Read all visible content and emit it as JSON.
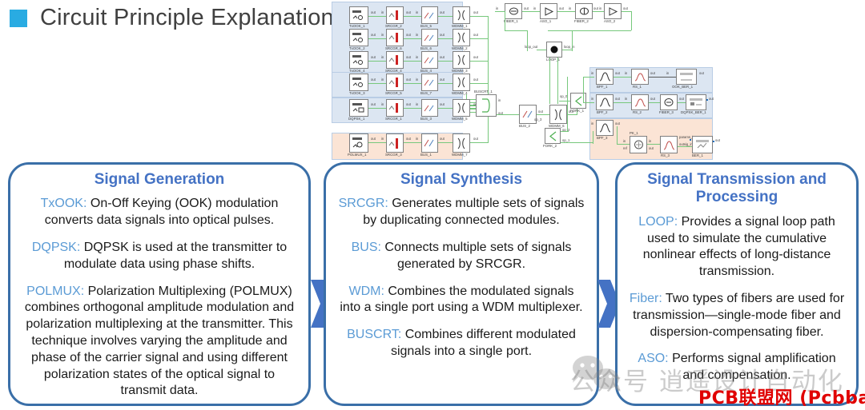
{
  "title": {
    "text": "Circuit Principle Explanation",
    "bullet_color": "#29ABE2",
    "text_color": "#404040"
  },
  "theme": {
    "panel_border": "#3a6fa8",
    "panel_title_color": "#4472C4",
    "keyword_color": "#5B9BD5",
    "arrow_color": "#4472C4",
    "region_blue": "#dce6f2",
    "region_peach": "#fbe4d5",
    "wire_color": "#77c87c"
  },
  "panels": [
    {
      "title": "Signal Generation",
      "paragraphs": [
        {
          "keyword": "TxOOK:",
          "text": " On-Off Keying (OOK) modulation converts data signals into optical pulses."
        },
        {
          "keyword": "DQPSK:",
          "text": " DQPSK is used at the transmitter to modulate data using phase shifts."
        },
        {
          "keyword": "POLMUX:",
          "text": " Polarization Multiplexing (POLMUX) combines orthogonal amplitude modulation and polarization multiplexing at the transmitter. This technique involves varying the amplitude and phase of the carrier signal and using different polarization states of the optical signal to transmit data."
        }
      ]
    },
    {
      "title": "Signal Synthesis",
      "paragraphs": [
        {
          "keyword": "SRCGR:",
          "text": " Generates multiple sets of signals by duplicating connected modules."
        },
        {
          "keyword": "BUS:",
          "text": " Connects multiple sets of signals generated by SRCGR."
        },
        {
          "keyword": "WDM:",
          "text": " Combines the modulated signals into a single port using a WDM multiplexer."
        },
        {
          "keyword": "BUSCRT:",
          "text": " Combines different modulated signals into a single port."
        }
      ]
    },
    {
      "title": "Signal Transmission and Processing",
      "paragraphs": [
        {
          "keyword": "LOOP:",
          "text": " Provides a signal loop path used to simulate the cumulative nonlinear effects of long-distance transmission."
        },
        {
          "keyword": "Fiber:",
          "text": " Two types of fibers are used for transmission—single-mode fiber and dispersion-compensating fiber."
        },
        {
          "keyword": "ASO:",
          "text": " Performs signal amplification and compensation."
        }
      ]
    }
  ],
  "diagram": {
    "rows": [
      {
        "blocks": [
          "TxOOK_1",
          "SRCGR_2",
          "BUS_5",
          "WDMM_1"
        ]
      },
      {
        "blocks": [
          "TxOOK_2",
          "SRCGR_6",
          "BUS_6",
          "WDMM_2"
        ]
      },
      {
        "blocks": [
          "TxOOK_4",
          "SRCGR_4",
          "BUS_4",
          "WDMM_3"
        ]
      },
      {
        "blocks": [
          "TxOOK_3",
          "SRCGR_5",
          "BUS_7",
          "WDMM_4"
        ]
      },
      {
        "blocks": [
          "DQPSK_1",
          "SRCGR_1",
          "BUS_3",
          "WDMM_5"
        ]
      },
      {
        "blocks": [
          "POLMUX_1",
          "SRCGR_3",
          "BUS_1",
          "WDMM_7"
        ]
      }
    ],
    "combiner": [
      "BUSCRT_1",
      "BUS_2",
      "WDMM_6"
    ],
    "loop_chain": [
      "FIBER_1",
      "ASO_1",
      "FIBER_2",
      "ASO_2"
    ],
    "loop_block": "LOOP_1",
    "loop_ports": [
      "loop_out",
      "loop_in"
    ],
    "forks": [
      "FORK_1",
      "FORK_2"
    ],
    "fork_ports": [
      "op_0",
      "op_1",
      "op_2",
      "op_3"
    ],
    "receivers": [
      {
        "blocks": [
          "BPF_1",
          "RS_1",
          "OOK_BER_1"
        ]
      },
      {
        "blocks": [
          "BPF_2",
          "RS_2",
          "FIBER_3",
          "DQPSK_BER_1"
        ]
      },
      {
        "blocks": [
          "BPF_3",
          "PK_1",
          "RS_3",
          "BER_1"
        ]
      }
    ],
    "port_labels": {
      "in": "in",
      "out": "out",
      "ref": "ref",
      "params_in": "params_in",
      "outsig_in": "outsig_in"
    }
  },
  "watermarks": {
    "wechat_text": "公众号 逍遥设计自动化",
    "pcb_text": "PCB联盟网 (Pcbbar.com)",
    "pcb_color": "#e00000"
  }
}
